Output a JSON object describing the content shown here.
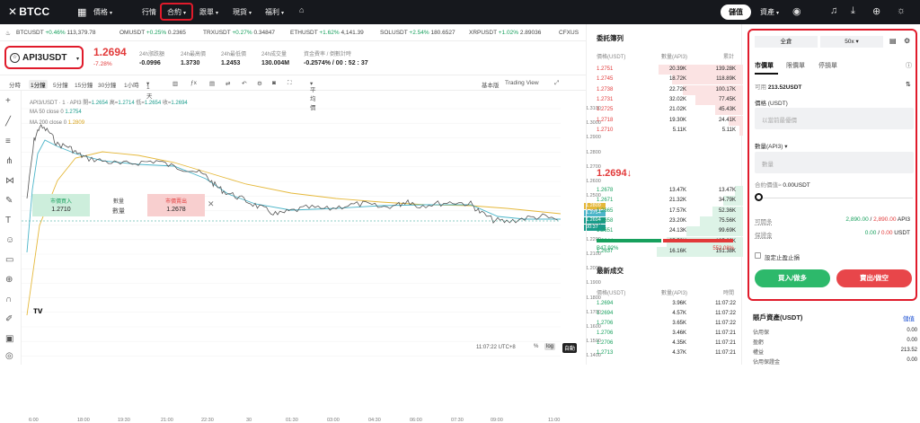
{
  "nav": {
    "logo": "BTCC",
    "items": [
      "價格",
      "行情",
      "合約",
      "跟單",
      "現貨",
      "福利"
    ],
    "deposit": "儲值",
    "assets": "資產"
  },
  "ticker": [
    {
      "sym": "BTCUSDT",
      "chg": "+0.46%",
      "px": "113,379.78"
    },
    {
      "sym": "OMUSDT",
      "chg": "+0.25%",
      "px": "0.2365"
    },
    {
      "sym": "TRXUSDT",
      "chg": "+0.27%",
      "px": "0.34847"
    },
    {
      "sym": "ETHUSDT",
      "chg": "+1.62%",
      "px": "4,141.39"
    },
    {
      "sym": "SOLUSDT",
      "chg": "+2.54%",
      "px": "180.6527"
    },
    {
      "sym": "XRPUSDT",
      "chg": "+1.02%",
      "px": "2.89036"
    },
    {
      "sym": "CFXUS",
      "chg": "",
      "px": ""
    }
  ],
  "pair": {
    "name": "API3USDT",
    "price": "1.2694",
    "change": "-7.28%",
    "stats": [
      {
        "l": "24h漲跌額",
        "v": "-0.0996",
        "red": true
      },
      {
        "l": "24h最高價",
        "v": "1.3730"
      },
      {
        "l": "24h最低價",
        "v": "1.2453"
      },
      {
        "l": "24h成交量",
        "v": "130.004M"
      },
      {
        "l": "資金費率 / 倒數計時",
        "v": "-0.2574% / 00 : 52 : 37"
      }
    ]
  },
  "toolbar": {
    "intervals": [
      "分時",
      "1分鐘",
      "5分鐘",
      "15分鐘",
      "30分鐘",
      "1小時",
      "1天"
    ],
    "active": "1分鐘",
    "indicator": "平均價",
    "basic": "基本版",
    "tv": "Trading View"
  },
  "chart": {
    "legend": "API3/USDT · 1 · API3",
    "open_l": "開=",
    "open": "1.2654",
    "high_l": "高=",
    "high": "1.2714",
    "low_l": "低=",
    "low": "1.2654",
    "close_l": "收=",
    "close": "1.2694",
    "ma50_l": "MA 50 close 0",
    "ma50": "1.2754",
    "ma200_l": "MA 200 close 0",
    "ma200": "1.2809",
    "quick": {
      "buy": "市價買入",
      "buy_px": "1.2710",
      "qty": "數量",
      "qty2": "數量",
      "sell": "市價賣出",
      "sell_px": "1.2678"
    },
    "yticks": [
      "1.3100",
      "1.3000",
      "1.2900",
      "1.2800",
      "1.2700",
      "1.2600",
      "1.2500",
      "1.2400",
      "1.2300",
      "1.2200",
      "1.2100",
      "1.2000",
      "1.1900",
      "1.1800",
      "1.1700",
      "1.1600",
      "1.1500",
      "1.1400"
    ],
    "tag1": "1.2809",
    "tag2": "1.2754",
    "tag3": "1.2694",
    "tag4": "00:37",
    "xticks": [
      "6:00",
      "18:00",
      "19:30",
      "21:00",
      "22:30",
      "30",
      "01:30",
      "03:00",
      "04:30",
      "06:00",
      "07:30",
      "09:00",
      "11:00"
    ],
    "clock": "11:07:22 UTC+8",
    "pct": "%",
    "log": "log",
    "auto": "自動"
  },
  "orderbook": {
    "title": "委託簿列",
    "h_price": "價格(USDT)",
    "h_qty": "數量(API3)",
    "h_total": "累計",
    "asks": [
      {
        "p": "1.2751",
        "q": "20.39K",
        "t": "139.28K",
        "w": 0.98
      },
      {
        "p": "1.2745",
        "q": "18.72K",
        "t": "118.89K",
        "w": 0.82
      },
      {
        "p": "1.2738",
        "q": "22.72K",
        "t": "100.17K",
        "w": 0.7
      },
      {
        "p": "1.2731",
        "q": "32.02K",
        "t": "77.45K",
        "w": 0.55
      },
      {
        "p": "1.2725",
        "q": "21.02K",
        "t": "45.43K",
        "w": 0.32
      },
      {
        "p": "1.2718",
        "q": "19.30K",
        "t": "24.41K",
        "w": 0.17
      },
      {
        "p": "1.2710",
        "q": "5.11K",
        "t": "5.11K",
        "w": 0.04
      }
    ],
    "mid": "1.2694",
    "mid_arrow": "↓",
    "bids": [
      {
        "p": "1.2678",
        "q": "13.47K",
        "t": "13.47K",
        "w": 0.09
      },
      {
        "p": "1.2671",
        "q": "21.32K",
        "t": "34.79K",
        "w": 0.23
      },
      {
        "p": "1.2665",
        "q": "17.57K",
        "t": "52.36K",
        "w": 0.35
      },
      {
        "p": "1.2658",
        "q": "23.20K",
        "t": "75.56K",
        "w": 0.5
      },
      {
        "p": "1.2651",
        "q": "24.13K",
        "t": "99.69K",
        "w": 0.66
      },
      {
        "p": "1.2644",
        "q": "35.53K",
        "t": "135.22K",
        "w": 0.89
      },
      {
        "p": "1.2637",
        "q": "16.16K",
        "t": "151.38K",
        "w": 1.0
      }
    ],
    "buy_ratio": "B47.92%",
    "sell_ratio": "552.08%",
    "buy_frac": 0.4792,
    "latest_title": "最新成交",
    "l_price": "價格(USDT)",
    "l_qty": "數量(API3)",
    "l_time": "時間",
    "trades": [
      {
        "p": "1.2694",
        "q": "3.96K",
        "t": "11:07:22"
      },
      {
        "p": "1.2694",
        "q": "4.57K",
        "t": "11:07:22"
      },
      {
        "p": "1.2706",
        "q": "3.65K",
        "t": "11:07:22"
      },
      {
        "p": "1.2706",
        "q": "3.46K",
        "t": "11:07:21"
      },
      {
        "p": "1.2706",
        "q": "4.35K",
        "t": "11:07:21"
      },
      {
        "p": "1.2713",
        "q": "4.37K",
        "t": "11:07:21"
      }
    ]
  },
  "order": {
    "margin_mode": "全倉",
    "leverage": "50x",
    "tabs": [
      "市價單",
      "限價單",
      "停損單"
    ],
    "avail_l": "可用",
    "avail": "213.52USDT",
    "price_l": "價格 (USDT)",
    "price_ph": "以當前最優價",
    "qty_l": "數量(API3)",
    "qty_ph": "數量",
    "contract_l": "合約價值≈",
    "contract": "0.00USDT",
    "open_l": "可開多",
    "open_a": "2,890.00",
    "open_b": "2,890.00",
    "open_u": "API3",
    "margin_l": "保證金",
    "margin_a": "0.00",
    "margin_b": "0.00",
    "margin_u": "USDT",
    "tpsl": "設定止盈止損",
    "buy": "買入/做多",
    "sell": "賣出/做空"
  },
  "assets": {
    "title": "賬戶資產(USDT)",
    "link": "儲值",
    "rows": [
      {
        "l": "佔用保",
        "v": "0.00"
      },
      {
        "l": "盈虧",
        "v": "0.00"
      },
      {
        "l": "權益",
        "v": "213.52"
      },
      {
        "l": "佔用保證金",
        "v": "0.00"
      }
    ]
  }
}
